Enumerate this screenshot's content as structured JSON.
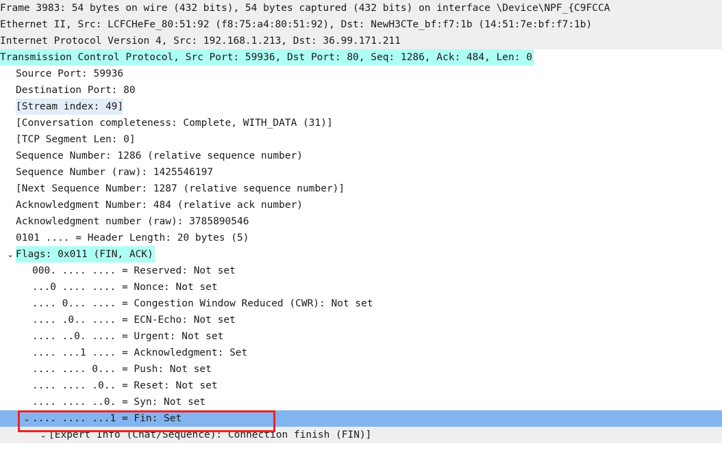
{
  "app": "wireshark-packet-details",
  "colors": {
    "protocol_highlight": "#aefff4",
    "selected_row": "#82b4f0",
    "generated_field": "#e4eefb",
    "summary_row": "#efefef",
    "annotation": "#f42020"
  },
  "annotation": {
    "shape": "rectangle",
    "target_row_label": "fin-flag-row",
    "color": "#f42020"
  },
  "rows": [
    {
      "id": "frame-summary",
      "level": 0,
      "chevron": "",
      "bg": "bg-gray",
      "text": "Frame 3983: 54 bytes on wire (432 bits), 54 bytes captured (432 bits) on interface \\Device\\NPF_{C9FCCA"
    },
    {
      "id": "ethernet-summary",
      "level": 0,
      "chevron": "",
      "bg": "bg-gray",
      "text": "Ethernet II, Src: LCFCHeFe_80:51:92 (f8:75:a4:80:51:92), Dst: NewH3CTe_bf:f7:1b (14:51:7e:bf:f7:1b)"
    },
    {
      "id": "ipv4-summary",
      "level": 0,
      "chevron": "",
      "bg": "bg-gray",
      "text": "Internet Protocol Version 4, Src: 192.168.1.213, Dst: 36.99.171.211"
    },
    {
      "id": "tcp-summary",
      "level": 0,
      "chevron": "",
      "bg": "bg-cyan",
      "text": "Transmission Control Protocol, Src Port: 59936, Dst Port: 80, Seq: 1286, Ack: 484, Len: 0"
    },
    {
      "id": "source-port",
      "level": 1,
      "chevron": "",
      "bg": "bg-white",
      "text": "Source Port: 59936"
    },
    {
      "id": "destination-port",
      "level": 1,
      "chevron": "",
      "bg": "bg-white",
      "text": "Destination Port: 80"
    },
    {
      "id": "stream-index",
      "level": 1,
      "chevron": "",
      "bg": "bg-litblue",
      "text": "[Stream index: 49]"
    },
    {
      "id": "conversation-completeness",
      "level": 1,
      "chevron": "",
      "bg": "bg-white",
      "text": "[Conversation completeness: Complete, WITH_DATA (31)]"
    },
    {
      "id": "tcp-segment-len",
      "level": 1,
      "chevron": "",
      "bg": "bg-white",
      "text": "[TCP Segment Len: 0]"
    },
    {
      "id": "sequence-number",
      "level": 1,
      "chevron": "",
      "bg": "bg-white",
      "text": "Sequence Number: 1286    (relative sequence number)"
    },
    {
      "id": "sequence-number-raw",
      "level": 1,
      "chevron": "",
      "bg": "bg-white",
      "text": "Sequence Number (raw): 1425546197"
    },
    {
      "id": "next-sequence-number",
      "level": 1,
      "chevron": "",
      "bg": "bg-white",
      "text": "[Next Sequence Number: 1287    (relative sequence number)]"
    },
    {
      "id": "acknowledgment-number",
      "level": 1,
      "chevron": "",
      "bg": "bg-white",
      "text": "Acknowledgment Number: 484    (relative ack number)"
    },
    {
      "id": "acknowledgment-number-raw",
      "level": 1,
      "chevron": "",
      "bg": "bg-white",
      "text": "Acknowledgment number (raw): 3785890546"
    },
    {
      "id": "header-length",
      "level": 1,
      "chevron": "",
      "bg": "bg-white",
      "text": "0101 .... = Header Length: 20 bytes (5)"
    },
    {
      "id": "flags-summary",
      "level": 1,
      "chevron": "⌄",
      "bg": "bg-cyan",
      "text": "Flags: 0x011 (FIN, ACK)"
    },
    {
      "id": "reserved-flag",
      "level": 2,
      "chevron": "",
      "bg": "bg-white",
      "text": "000. .... .... = Reserved: Not set"
    },
    {
      "id": "nonce-flag",
      "level": 2,
      "chevron": "",
      "bg": "bg-white",
      "text": "...0 .... .... = Nonce: Not set"
    },
    {
      "id": "cwr-flag",
      "level": 2,
      "chevron": "",
      "bg": "bg-white",
      "text": ".... 0... .... = Congestion Window Reduced (CWR): Not set"
    },
    {
      "id": "ecn-echo-flag",
      "level": 2,
      "chevron": "",
      "bg": "bg-white",
      "text": ".... .0.. .... = ECN-Echo: Not set"
    },
    {
      "id": "urgent-flag",
      "level": 2,
      "chevron": "",
      "bg": "bg-white",
      "text": ".... ..0. .... = Urgent: Not set"
    },
    {
      "id": "acknowledgment-flag",
      "level": 2,
      "chevron": "",
      "bg": "bg-white",
      "text": ".... ...1 .... = Acknowledgment: Set"
    },
    {
      "id": "push-flag",
      "level": 2,
      "chevron": "",
      "bg": "bg-white",
      "text": ".... .... 0... = Push: Not set"
    },
    {
      "id": "reset-flag",
      "level": 2,
      "chevron": "",
      "bg": "bg-white",
      "text": ".... .... .0.. = Reset: Not set"
    },
    {
      "id": "syn-flag",
      "level": 2,
      "chevron": "",
      "bg": "bg-white",
      "text": ".... .... ..0. = Syn: Not set"
    },
    {
      "id": "fin-flag",
      "level": 2,
      "chevron": "⌄",
      "bg": "bg-sel",
      "text": ".... .... ...1 = Fin: Set"
    },
    {
      "id": "expert-info",
      "level": 3,
      "chevron": "⌄",
      "bg": "bg-gray",
      "text": "[Expert Info (Chat/Sequence): Connection finish (FIN)]"
    }
  ]
}
